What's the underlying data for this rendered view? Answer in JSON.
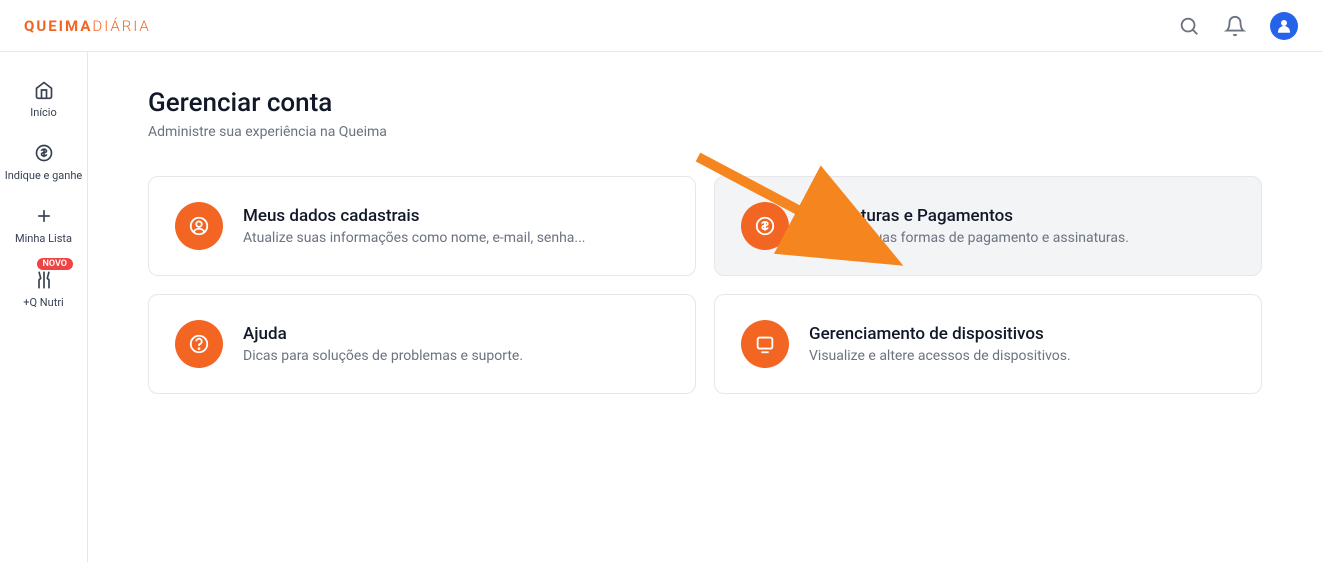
{
  "brand": {
    "part1": "QUEIMA",
    "part2": "DIÁRIA"
  },
  "sidebar": {
    "items": [
      {
        "label": "Início"
      },
      {
        "label": "Indique e ganhe"
      },
      {
        "label": "Minha Lista"
      },
      {
        "label": "+Q Nutri",
        "badge": "NOVO"
      }
    ]
  },
  "page": {
    "title": "Gerenciar conta",
    "subtitle": "Administre sua experiência na Queima"
  },
  "cards": [
    {
      "title": "Meus dados cadastrais",
      "desc": "Atualize suas informações como nome, e-mail, senha..."
    },
    {
      "title": "Assinaturas e Pagamentos",
      "desc": "Gerencie suas formas de pagamento e assinaturas."
    },
    {
      "title": "Ajuda",
      "desc": "Dicas para soluções de problemas e suporte."
    },
    {
      "title": "Gerenciamento de dispositivos",
      "desc": "Visualize e altere acessos de dispositivos."
    }
  ],
  "colors": {
    "accent": "#f26522",
    "blue": "#2563eb",
    "red": "#ef4444"
  }
}
